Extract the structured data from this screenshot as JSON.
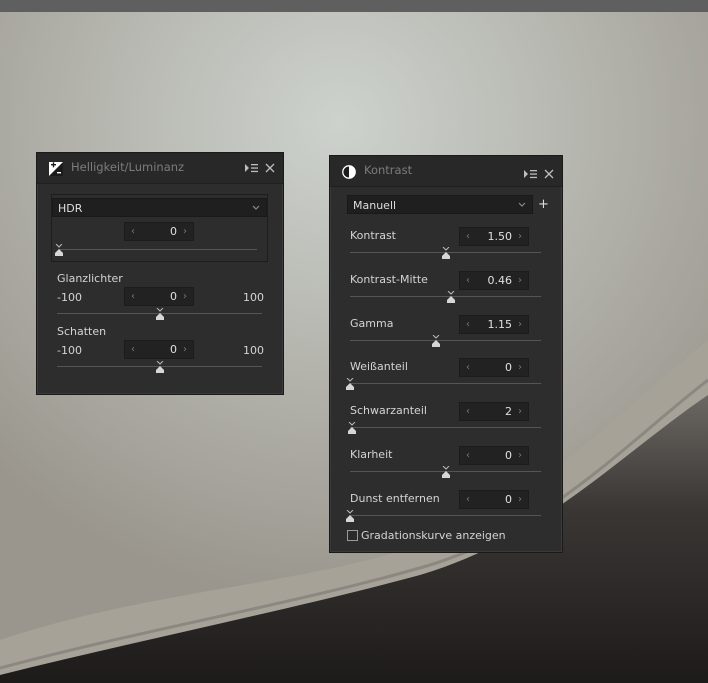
{
  "colors": {
    "panel_bg": "#2d2d2d",
    "title_text": "#7c7c7c"
  },
  "brightness_panel": {
    "title": "Helligkeit/Luminanz",
    "icon": "brightness-icon",
    "mode": "HDR",
    "hdr_value": "0",
    "hdr_level": 0,
    "highlights": {
      "label": "Glanzlichter",
      "min": "-100",
      "max": "100",
      "value": "0",
      "level": 0.5
    },
    "shadows": {
      "label": "Schatten",
      "min": "-100",
      "max": "100",
      "value": "0",
      "level": 0.5
    }
  },
  "contrast_panel": {
    "title": "Kontrast",
    "icon": "contrast-icon",
    "mode": "Manuell",
    "items": [
      {
        "label": "Kontrast",
        "value": "1.50",
        "level": 0.5
      },
      {
        "label": "Kontrast-Mitte",
        "value": "0.46",
        "level": 0.53
      },
      {
        "label": "Gamma",
        "value": "1.15",
        "level": 0.45
      },
      {
        "label": "Weißanteil",
        "value": "0",
        "level": 0
      },
      {
        "label": "Schwarzanteil",
        "value": "2",
        "level": 0.01
      },
      {
        "label": "Klarheit",
        "value": "0",
        "level": 0.5
      },
      {
        "label": "Dunst entfernen",
        "value": "0",
        "level": 0
      }
    ],
    "show_curve_label": "Gradationskurve anzeigen",
    "show_curve_checked": false
  }
}
